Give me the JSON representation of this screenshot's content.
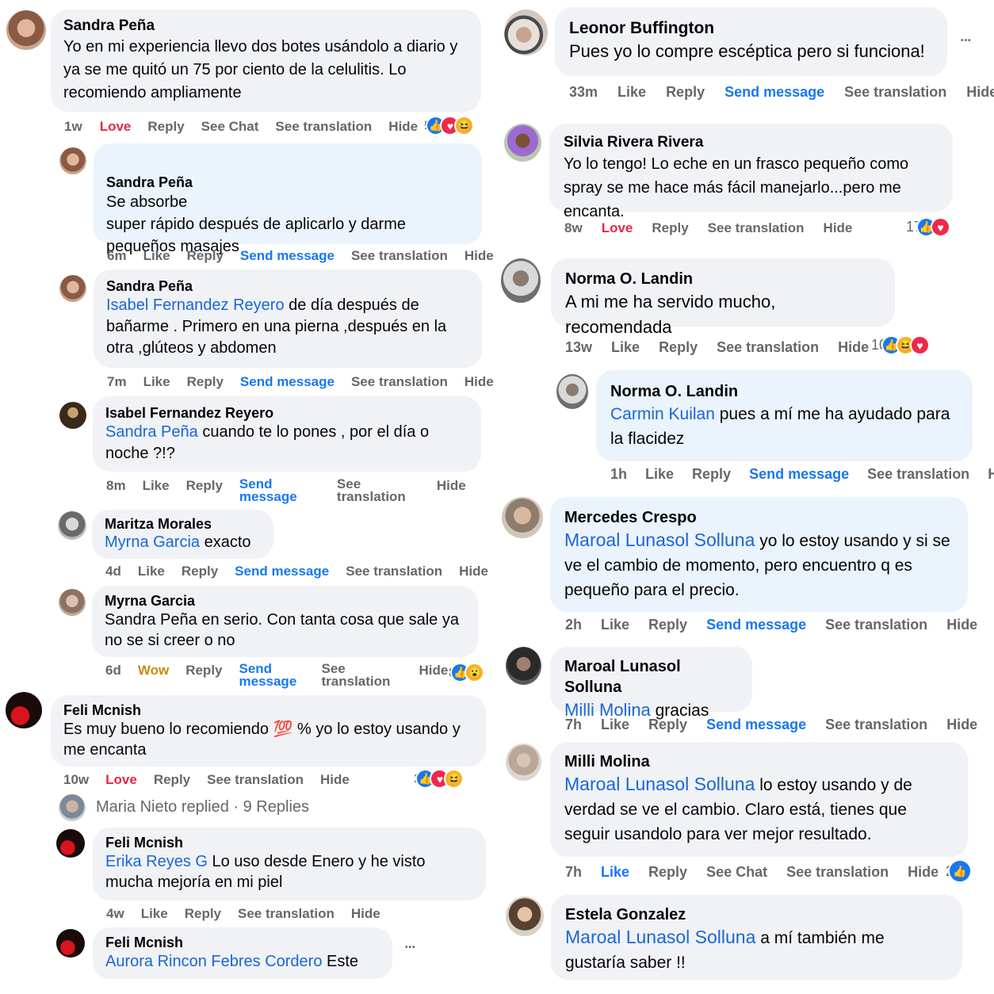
{
  "common": {
    "like": "Like",
    "reply": "Reply",
    "love": "Love",
    "wow": "Wow",
    "see_chat": "See Chat",
    "see_translation": "See translation",
    "send_message": "Send message",
    "hide": "Hide",
    "send": "Send",
    "message": "message",
    "see": "See",
    "translation": "translation",
    "more": "•••"
  },
  "left": [
    {
      "author": "Sandra Peña",
      "text": "Yo en mi experiencia llevo dos botes usándolo a diario y ya se me quitó un 75 por ciento de la celulitis. Lo recomiendo ampliamente",
      "time": "1w",
      "reactions": "5"
    },
    {
      "author": "Sandra Peña",
      "text": "Se absorbe\nsuper rápido después de aplicarlo y darme pequeños masajes",
      "time": "6m"
    },
    {
      "author": "Sandra Peña",
      "mention": "Isabel Fernandez Reyero",
      "text": " de día después de bañarme . Primero en una pierna ,después en la otra ,glúteos y abdomen",
      "time": "7m"
    },
    {
      "author": "Isabel Fernandez Reyero",
      "mention": "Sandra Peña",
      "text": " cuando te lo pones , por el día o noche ?!?",
      "time": "8m"
    },
    {
      "author": "Maritza Morales",
      "mention": "Myrna Garcia",
      "text": " exacto",
      "time": "4d"
    },
    {
      "author": "Myrna Garcia",
      "text": "Sandra Peña en serio. Con tanta cosa que sale ya no se si creer o no",
      "time": "6d",
      "reactions": "8"
    },
    {
      "author": "Feli Mcnish",
      "text": "Es muy bueno lo recomiendo ",
      "emoji": "💯",
      "text2": " % yo lo estoy usando y me encanta",
      "time": "10w",
      "reactions": "3"
    },
    {
      "author": "Feli Mcnish",
      "mention": "Erika Reyes G",
      "text": " Lo uso desde Enero y he visto mucha mejoría en mi piel",
      "time": "4w"
    },
    {
      "author": "Feli Mcnish",
      "mention": "Aurora Rincon Febres Cordero",
      "text": " Este"
    }
  ],
  "replied": "Maria Nieto replied · 9 Replies",
  "right": [
    {
      "author": "Leonor Buffington",
      "text": "Pues yo lo compre escéptica pero si funciona!",
      "time": "33m"
    },
    {
      "author": "Silvia Rivera Rivera",
      "text": "Yo lo tengo! Lo eche en un frasco pequeño como spray se me hace más fácil manejarlo...pero me encanta.",
      "time": "8w",
      "reactions": "17"
    },
    {
      "author": "Norma O. Landin",
      "text": "A mi me ha servido mucho, recomendada",
      "time": "13w",
      "reactions": "10"
    },
    {
      "author": "Norma O. Landin",
      "mention": "Carmin Kuilan",
      "text": " pues a mí me ha ayudado para la flacidez",
      "time": "1h"
    },
    {
      "author": "Mercedes Crespo",
      "mention": "Maroal Lunasol Solluna",
      "text": " yo lo estoy usando y si se ve el cambio de momento, pero encuentro q es pequeño para el precio.",
      "time": "2h"
    },
    {
      "author": "Maroal Lunasol Solluna",
      "mention": "Milli Molina",
      "text": " gracias",
      "time": "7h"
    },
    {
      "author": "Milli Molina",
      "mention": "Maroal Lunasol Solluna",
      "text": " lo estoy usando y de verdad se ve el cambio. Claro está, tienes que seguir usandolo para ver mejor resultado.",
      "time": "7h",
      "reactions": "2"
    },
    {
      "author": "Estela Gonzalez",
      "mention": "Maroal Lunasol Solluna",
      "text": " a mí también me gustaría saber !!"
    }
  ]
}
